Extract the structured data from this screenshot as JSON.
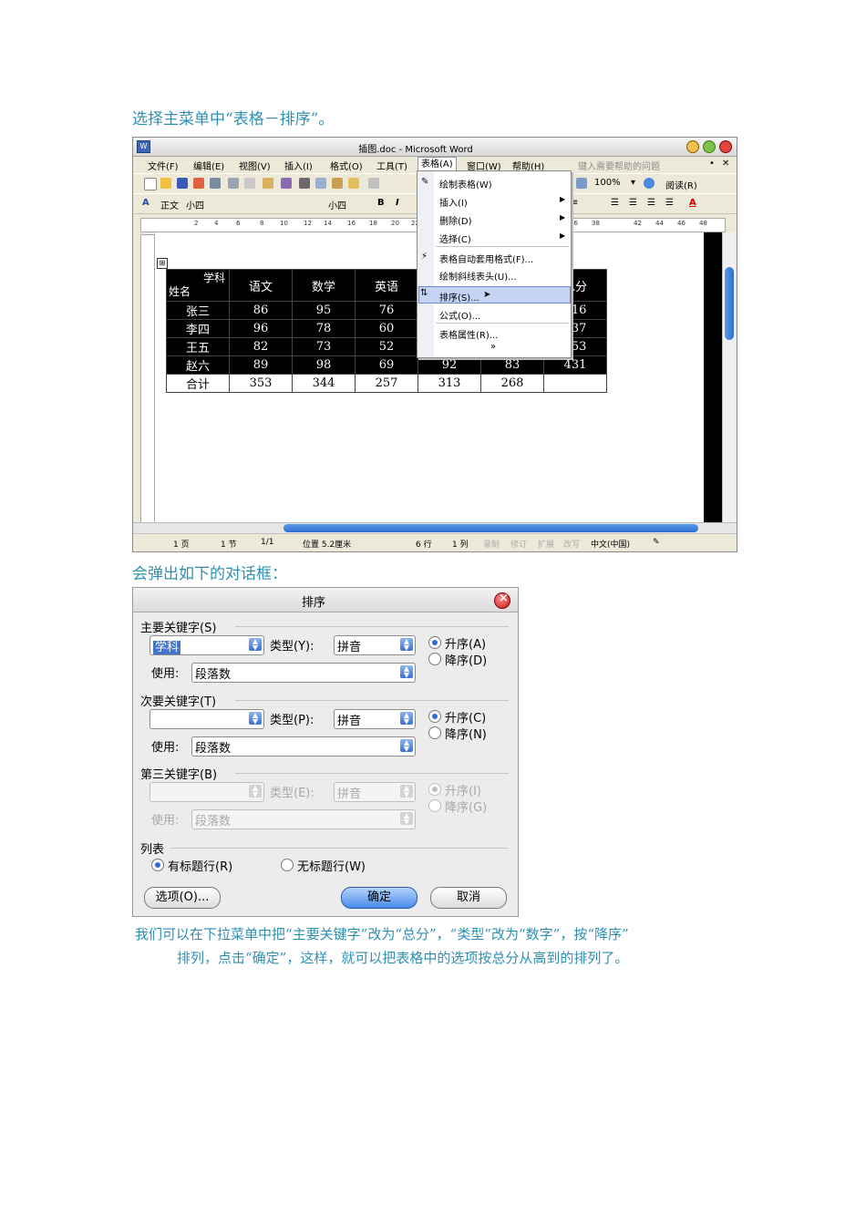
{
  "captions": {
    "intro": "选择主菜单中“表格－排序”。",
    "dialog_intro": "会弹出如下的对话框：",
    "explain_line1": "我们可以在下拉菜单中把“主要关键字”改为“总分”，“类型”改为“数字”，按“降序”",
    "explain_line2": "排列，点击“确定”，这样，就可以把表格中的选项按总分从高到的排列了。"
  },
  "word": {
    "title": "插图.doc - Microsoft Word",
    "menus": [
      "文件(F)",
      "编辑(E)",
      "视图(V)",
      "插入(I)",
      "格式(O)",
      "工具(T)",
      "表格(A)",
      "窗口(W)",
      "帮助(H)"
    ],
    "help_placeholder": "键入需要帮助的问题",
    "zoom": "100%",
    "read_mode": "阅读(R)",
    "style": "正文",
    "size_label": "小四",
    "font": "小四",
    "ruler_ticks": [
      "2",
      "4",
      "6",
      "8",
      "10",
      "12",
      "14",
      "16",
      "18",
      "20",
      "22",
      "36",
      "38",
      "42",
      "44",
      "46",
      "48"
    ],
    "table": {
      "header_corner_top": "学科",
      "header_corner_bottom": "姓名",
      "headers": [
        "语文",
        "数学",
        "英语",
        "",
        "",
        "总分"
      ],
      "rows": [
        [
          "张三",
          "86",
          "95",
          "76",
          "",
          "",
          "416"
        ],
        [
          "李四",
          "96",
          "78",
          "60",
          "",
          "",
          "337"
        ],
        [
          "王五",
          "82",
          "73",
          "52",
          "",
          "",
          "353"
        ],
        [
          "赵六",
          "89",
          "98",
          "69",
          "92",
          "83",
          "431"
        ]
      ],
      "total": [
        "合计",
        "353",
        "344",
        "257",
        "313",
        "268",
        ""
      ]
    },
    "table_menu": {
      "items": [
        "绘制表格(W)",
        "插入(I)",
        "删除(D)",
        "选择(C)",
        "表格自动套用格式(F)...",
        "绘制斜线表头(U)...",
        "排序(S)...",
        "公式(O)...",
        "表格属性(R)..."
      ],
      "more": "»"
    },
    "status": {
      "page": "1 页",
      "section": "1 节",
      "pages": "1/1",
      "position": "位置 5.2厘米",
      "line": "6 行",
      "column": "1 列",
      "rec": "录制",
      "trk": "修订",
      "ext": "扩展",
      "ovr": "改写",
      "lang": "中文(中国)"
    }
  },
  "dialog": {
    "title": "排序",
    "key1": {
      "label": "主要关键字(S)",
      "value": "学科",
      "type_label": "类型(Y):",
      "type_value": "拼音",
      "use_label": "使用:",
      "use_value": "段落数",
      "asc": "升序(A)",
      "desc": "降序(D)"
    },
    "key2": {
      "label": "次要关键字(T)",
      "value": "",
      "type_label": "类型(P):",
      "type_value": "拼音",
      "use_label": "使用:",
      "use_value": "段落数",
      "asc": "升序(C)",
      "desc": "降序(N)"
    },
    "key3": {
      "label": "第三关键字(B)",
      "value": "",
      "type_label": "类型(E):",
      "type_value": "拼音",
      "use_label": "使用:",
      "use_value": "段落数",
      "asc": "升序(I)",
      "desc": "降序(G)"
    },
    "list": {
      "label": "列表",
      "with_header": "有标题行(R)",
      "without_header": "无标题行(W)"
    },
    "buttons": {
      "options": "选项(O)...",
      "ok": "确定",
      "cancel": "取消"
    }
  }
}
